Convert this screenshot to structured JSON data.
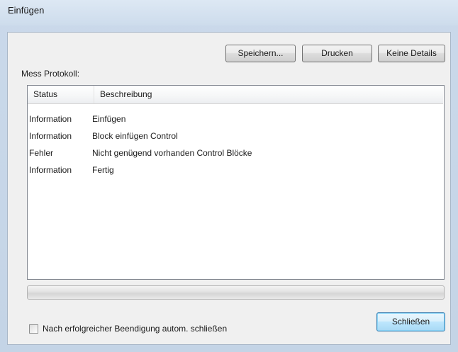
{
  "window": {
    "title": "Einfügen"
  },
  "toolbar": {
    "save_label": "Speichern...",
    "print_label": "Drucken",
    "details_label": "Keine Details"
  },
  "log": {
    "label": "Mess Protokoll:",
    "columns": [
      "Status",
      "Beschreibung"
    ],
    "rows": [
      {
        "status": "Information",
        "description": "Einfügen"
      },
      {
        "status": "Information",
        "description": "Block einfügen Control"
      },
      {
        "status": "Fehler",
        "description": "Nicht genügend vorhanden Control Blöcke"
      },
      {
        "status": "Information",
        "description": "Fertig"
      }
    ]
  },
  "progress": {
    "value": 0
  },
  "footer": {
    "autoclose_label": "Nach erfolgreicher Beendigung autom. schließen",
    "autoclose_checked": false,
    "close_label": "Schließen"
  },
  "colors": {
    "titlebar": "#cddcec",
    "client": "#f0f0f0",
    "default_button_border": "#3c7fb1"
  }
}
